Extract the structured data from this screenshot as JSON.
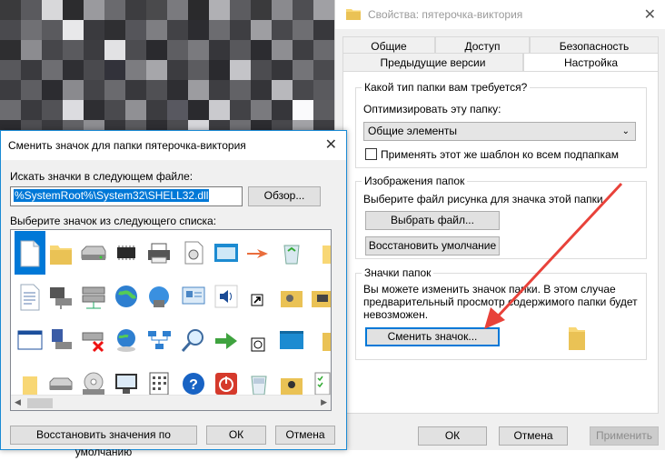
{
  "background": {
    "mosaic_colors": [
      "#3a3a3c",
      "#5a5a5e",
      "#d8d8da",
      "#2c2c2e",
      "#9a9a9e",
      "#6a6a6e",
      "#3d3d40",
      "#4a4a4c",
      "#7a7a7e",
      "#2a2a2c",
      "#b0b0b4",
      "#5c5c60",
      "#3a3a3c",
      "#8a8a8e",
      "#4e4e52",
      "#a0a0a4",
      "#4a4a4e",
      "#707074",
      "#5a5a5e",
      "#e8e8ea",
      "#3a3a3e",
      "#2f2f32",
      "#55555a",
      "#7e7e82",
      "#424246",
      "#2c2c30",
      "#6c6c70",
      "#3e3e42",
      "#9e9ea2",
      "#48484c",
      "#6e6e72",
      "#38383c",
      "#2e2e30",
      "#8c8c90",
      "#46464a",
      "#5a5a5e",
      "#3c3c40",
      "#e2e2e4",
      "#4c4c50",
      "#2a2a2e",
      "#5e5e62",
      "#7a7a7e",
      "#36363a",
      "#58585c",
      "#2c2c30",
      "#8e8e92",
      "#3e3e42",
      "#6a6a6e",
      "#58585c",
      "#3a3a3e",
      "#6e6e72",
      "#2f2f33",
      "#4a4a4e",
      "#32323a",
      "#7c7c80",
      "#a6a6aa",
      "#3c3c40",
      "#5c5c60",
      "#2a2a2e",
      "#c4c4c8",
      "#4c4c50",
      "#36363a",
      "#747478",
      "#4a4a4e",
      "#3c3c40",
      "#5e5e62",
      "#2c2c30",
      "#8a8a8e",
      "#444448",
      "#6a6a6e",
      "#38383c",
      "#505054",
      "#2e2e32",
      "#9c9ca0",
      "#3e3e42",
      "#626266",
      "#343438",
      "#b8b8bc",
      "#48484c",
      "#5a5a5e",
      "#6c6c70",
      "#3a3a3e",
      "#525256",
      "#dcdce0",
      "#2e2e32",
      "#4a4a4e",
      "#909094",
      "#3c3c40",
      "#585860",
      "#2a2a2e",
      "#cacace",
      "#424246",
      "#7a7a7e",
      "#36363a",
      "#fafafc",
      "#5c5c60",
      "#2c2c30",
      "#4e4e52",
      "#3a3a3e",
      "#626266",
      "#8e8e92",
      "#36363a",
      "#5a5a5e",
      "#2e2e32",
      "#4c4c50",
      "#d6d6da",
      "#3c3c40",
      "#6e6e72",
      "#2c2c30",
      "#48484c",
      "#a2a2a6",
      "#3e3e42"
    ]
  },
  "props": {
    "title": "Свойства: пятерочка-виктория",
    "tabs_row1": [
      "Общие",
      "Доступ",
      "Безопасность"
    ],
    "tabs_row2": [
      "Предыдущие версии",
      "Настройка"
    ],
    "group1": {
      "legend": "Какой тип папки вам требуется?",
      "optimize_label": "Оптимизировать эту папку:",
      "select_value": "Общие элементы",
      "checkbox_label": "Применять этот же шаблон ко всем подпапкам"
    },
    "group2": {
      "legend": "Изображения папок",
      "desc": "Выберите файл рисунка для значка этой папки.",
      "choose_file": "Выбрать файл...",
      "restore_default": "Восстановить умолчание"
    },
    "group3": {
      "legend": "Значки папок",
      "desc_lines": [
        "Вы можете изменить значок папки. В этом случае",
        "предварительный просмотр содержимого папки будет",
        "невозможен."
      ],
      "change_icon": "Сменить значок..."
    },
    "ok": "ОК",
    "cancel": "Отмена",
    "apply": "Применить",
    "arrow_color": "#e8423a"
  },
  "dialog": {
    "title": "Сменить значок для папки пятерочка-виктория",
    "search_label": "Искать значки в следующем файле:",
    "file_path": "%SystemRoot%\\System32\\SHELL32.dll",
    "browse": "Обзор...",
    "list_label": "Выберите значок из следующего списка:",
    "restore_defaults": "Восстановить значения по умолчанию",
    "ok": "ОК",
    "cancel": "Отмена",
    "icons": [
      [
        "blank-document-icon",
        "folder-icon",
        "hard-drive-icon",
        "chip-icon",
        "printer-icon",
        "mobile-device-icon",
        "window-icon",
        "arrow-hand-icon",
        "recycle-bin-icon",
        "folder-partial-icon"
      ],
      [
        "text-document-icon",
        "network-computer-icon",
        "network-drives-icon",
        "globe-icon",
        "network-globe-icon",
        "control-panel-icon",
        "sound-icon",
        "shortcut-arrow-icon",
        "tools-folder-icon",
        "printer-folder-icon"
      ],
      [
        "application-window-icon",
        "floppy-computer-icon",
        "network-drive-disabled-icon",
        "globe-cd-icon",
        "network-icon",
        "search-icon",
        "download-arrow-icon",
        "clock-icon",
        "blue-screen-icon",
        "folder-partial2-icon"
      ],
      [
        "folder-small-icon",
        "drive-icon",
        "cd-drive-icon",
        "monitor-icon",
        "keypad-icon",
        "help-icon",
        "power-icon",
        "recycle-full-icon",
        "users-folder-icon",
        "checklist-icon"
      ]
    ]
  }
}
